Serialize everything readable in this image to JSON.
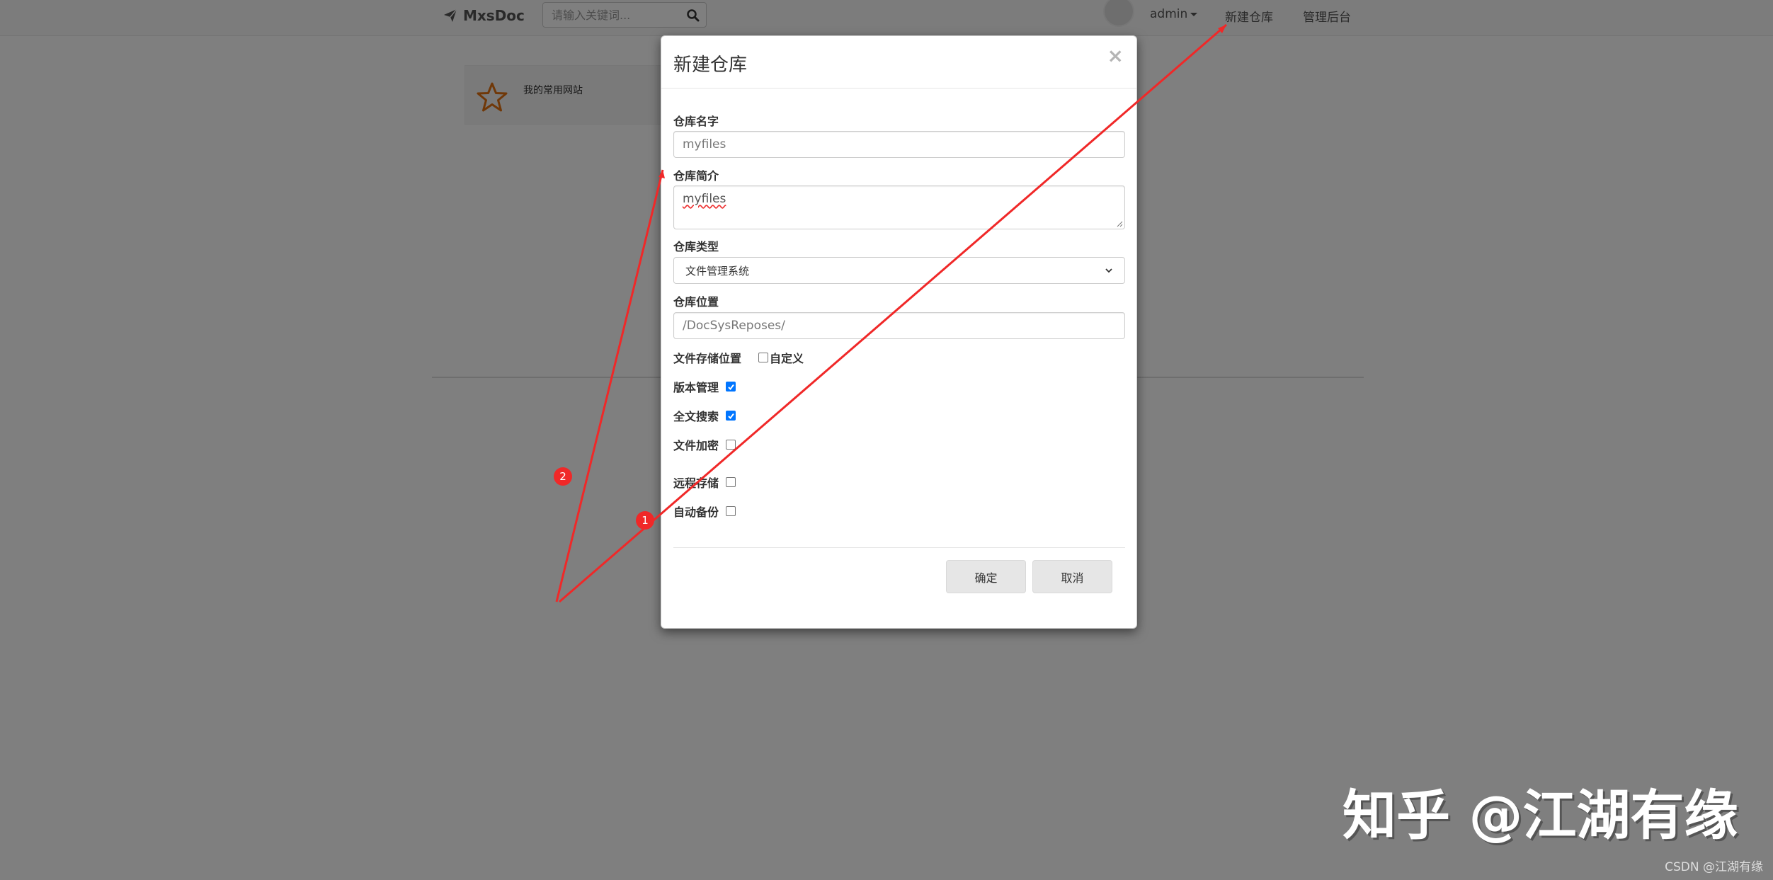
{
  "navbar": {
    "brand": "MxsDoc",
    "search_placeholder": "请输入关键词...",
    "user": "admin",
    "new_repo_link": "新建仓库",
    "manage_link": "管理后台"
  },
  "favorites": {
    "label": "我的常用网站"
  },
  "modal": {
    "title": "新建仓库",
    "close_glyph": "×",
    "repo_name": {
      "label": "仓库名字",
      "value": "myfiles"
    },
    "repo_intro": {
      "label": "仓库简介",
      "value": "myfiles"
    },
    "repo_type": {
      "label": "仓库类型",
      "selected": "文件管理系统"
    },
    "repo_location": {
      "label": "仓库位置",
      "value": "/DocSysReposes/"
    },
    "file_storage": {
      "label": "文件存储位置",
      "custom_label": "自定义",
      "custom_checked": false
    },
    "version_mgmt": {
      "label": "版本管理",
      "checked": true
    },
    "fulltext_search": {
      "label": "全文搜索",
      "checked": true
    },
    "file_encrypt": {
      "label": "文件加密",
      "checked": false
    },
    "remote_storage": {
      "label": "远程存储",
      "checked": false
    },
    "auto_backup": {
      "label": "自动备份",
      "checked": false
    },
    "ok_button": "确定",
    "cancel_button": "取消"
  },
  "annotations": {
    "badge_1": "1",
    "badge_2": "2",
    "color": "#f02828"
  },
  "watermark": "知乎 @江湖有缘",
  "credit": "CSDN @江湖有缘",
  "colors": {
    "backdrop": "rgba(0,0,0,0.5)",
    "checkbox_checked": "#0075ff"
  }
}
